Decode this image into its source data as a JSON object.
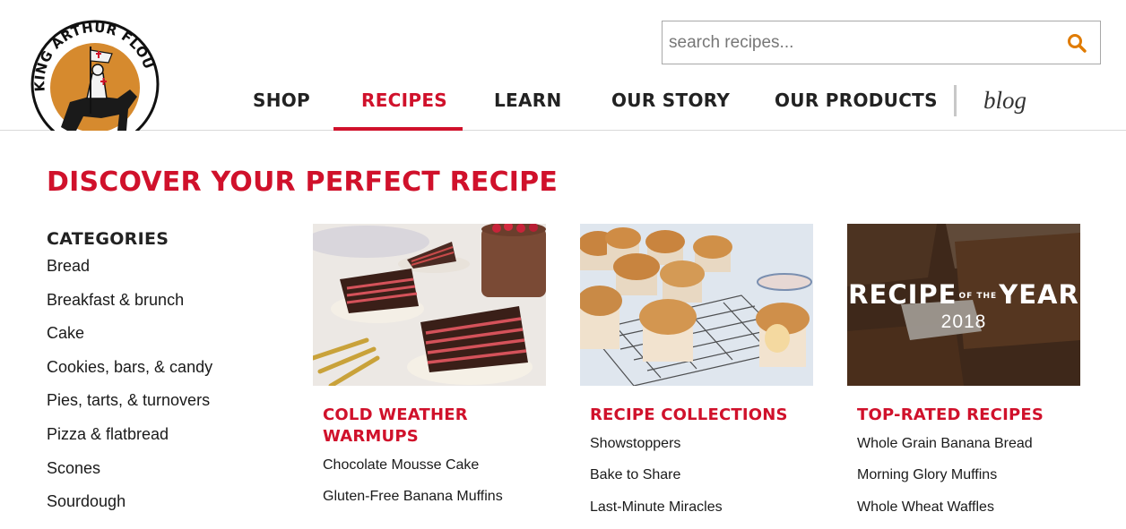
{
  "brand": {
    "logo_text": "KING ARTHUR FLOUR"
  },
  "search": {
    "placeholder": "search recipes...",
    "value": ""
  },
  "nav": {
    "items": [
      {
        "label": "SHOP",
        "active": false
      },
      {
        "label": "RECIPES",
        "active": true
      },
      {
        "label": "LEARN",
        "active": false
      },
      {
        "label": "OUR STORY",
        "active": false
      },
      {
        "label": "OUR PRODUCTS",
        "active": false
      }
    ],
    "blog_label": "blog"
  },
  "page": {
    "title": "DISCOVER YOUR PERFECT RECIPE"
  },
  "categories": {
    "heading": "CATEGORIES",
    "items": [
      "Bread",
      "Breakfast & brunch",
      "Cake",
      "Cookies, bars, & candy",
      "Pies, tarts, & turnovers",
      "Pizza & flatbread",
      "Scones",
      "Sourdough"
    ]
  },
  "cards": [
    {
      "title": "COLD WEATHER WARMUPS",
      "links": [
        "Chocolate Mousse Cake",
        "Gluten-Free Banana Muffins"
      ]
    },
    {
      "title": "RECIPE COLLECTIONS",
      "links": [
        "Showstoppers",
        "Bake to Share",
        "Last-Minute Miracles"
      ]
    },
    {
      "title": "TOP-RATED RECIPES",
      "overlay": {
        "line1": "RECIPE",
        "of_the": "OF THE",
        "line2": "YEAR",
        "year": "2018"
      },
      "links": [
        "Whole Grain Banana Bread",
        "Morning Glory Muffins",
        "Whole Wheat Waffles"
      ]
    }
  ],
  "colors": {
    "accent": "#d0112b",
    "search_icon": "#e07b00",
    "text": "#1a1a1a"
  }
}
